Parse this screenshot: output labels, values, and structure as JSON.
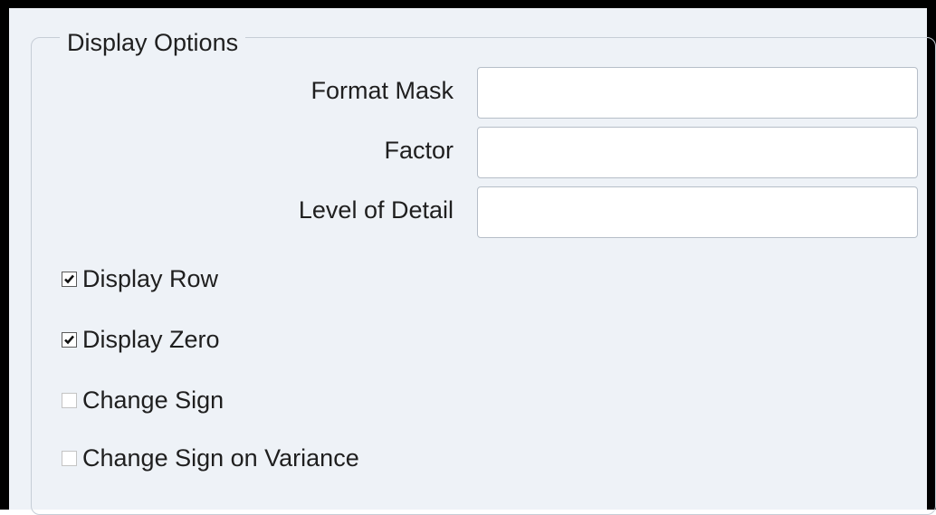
{
  "section": {
    "legend": "Display Options"
  },
  "fields": {
    "format_mask": {
      "label": "Format Mask",
      "value": ""
    },
    "factor": {
      "label": "Factor",
      "value": ""
    },
    "level_of_detail": {
      "label": "Level of Detail",
      "value": ""
    }
  },
  "checkboxes": {
    "display_row": {
      "label": "Display Row",
      "checked": true
    },
    "display_zero": {
      "label": "Display Zero",
      "checked": true
    },
    "change_sign": {
      "label": "Change Sign",
      "checked": false
    },
    "change_sign_on_variance": {
      "label": "Change Sign on Variance",
      "checked": false
    }
  }
}
